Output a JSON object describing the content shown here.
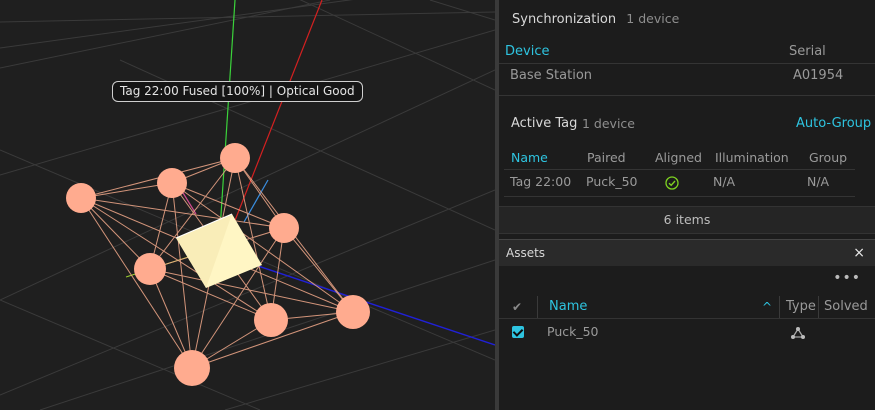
{
  "viewport": {
    "tag_label": "Tag 22:00 Fused [100%] | Optical Good"
  },
  "synchronization": {
    "title": "Synchronization",
    "count": "1 device",
    "columns": {
      "device": "Device",
      "serial": "Serial"
    },
    "rows": [
      {
        "device": "Base Station",
        "serial": "A01954"
      }
    ]
  },
  "active_tag": {
    "title": "Active Tag",
    "count": "1 device",
    "auto_group": "Auto-Group",
    "columns": {
      "name": "Name",
      "paired": "Paired",
      "aligned": "Aligned",
      "illumination": "Illumination",
      "group": "Group"
    },
    "rows": [
      {
        "name": "Tag 22:00",
        "paired": "Puck_50",
        "aligned_icon": "check-circle-icon",
        "illumination": "N/A",
        "group": "N/A"
      }
    ],
    "items": "6 items"
  },
  "assets": {
    "title": "Assets",
    "close": "×",
    "more": "•••",
    "columns": {
      "check": "✔",
      "name": "Name",
      "sort": "^",
      "type": "Type",
      "solved": "Solved"
    },
    "rows": [
      {
        "name": "Puck_50",
        "type_icon": "rigid-body-icon"
      }
    ]
  },
  "colors": {
    "accent": "#2ec4e0",
    "marker": "#ffab8f",
    "aligned_ok": "#7ed321"
  }
}
